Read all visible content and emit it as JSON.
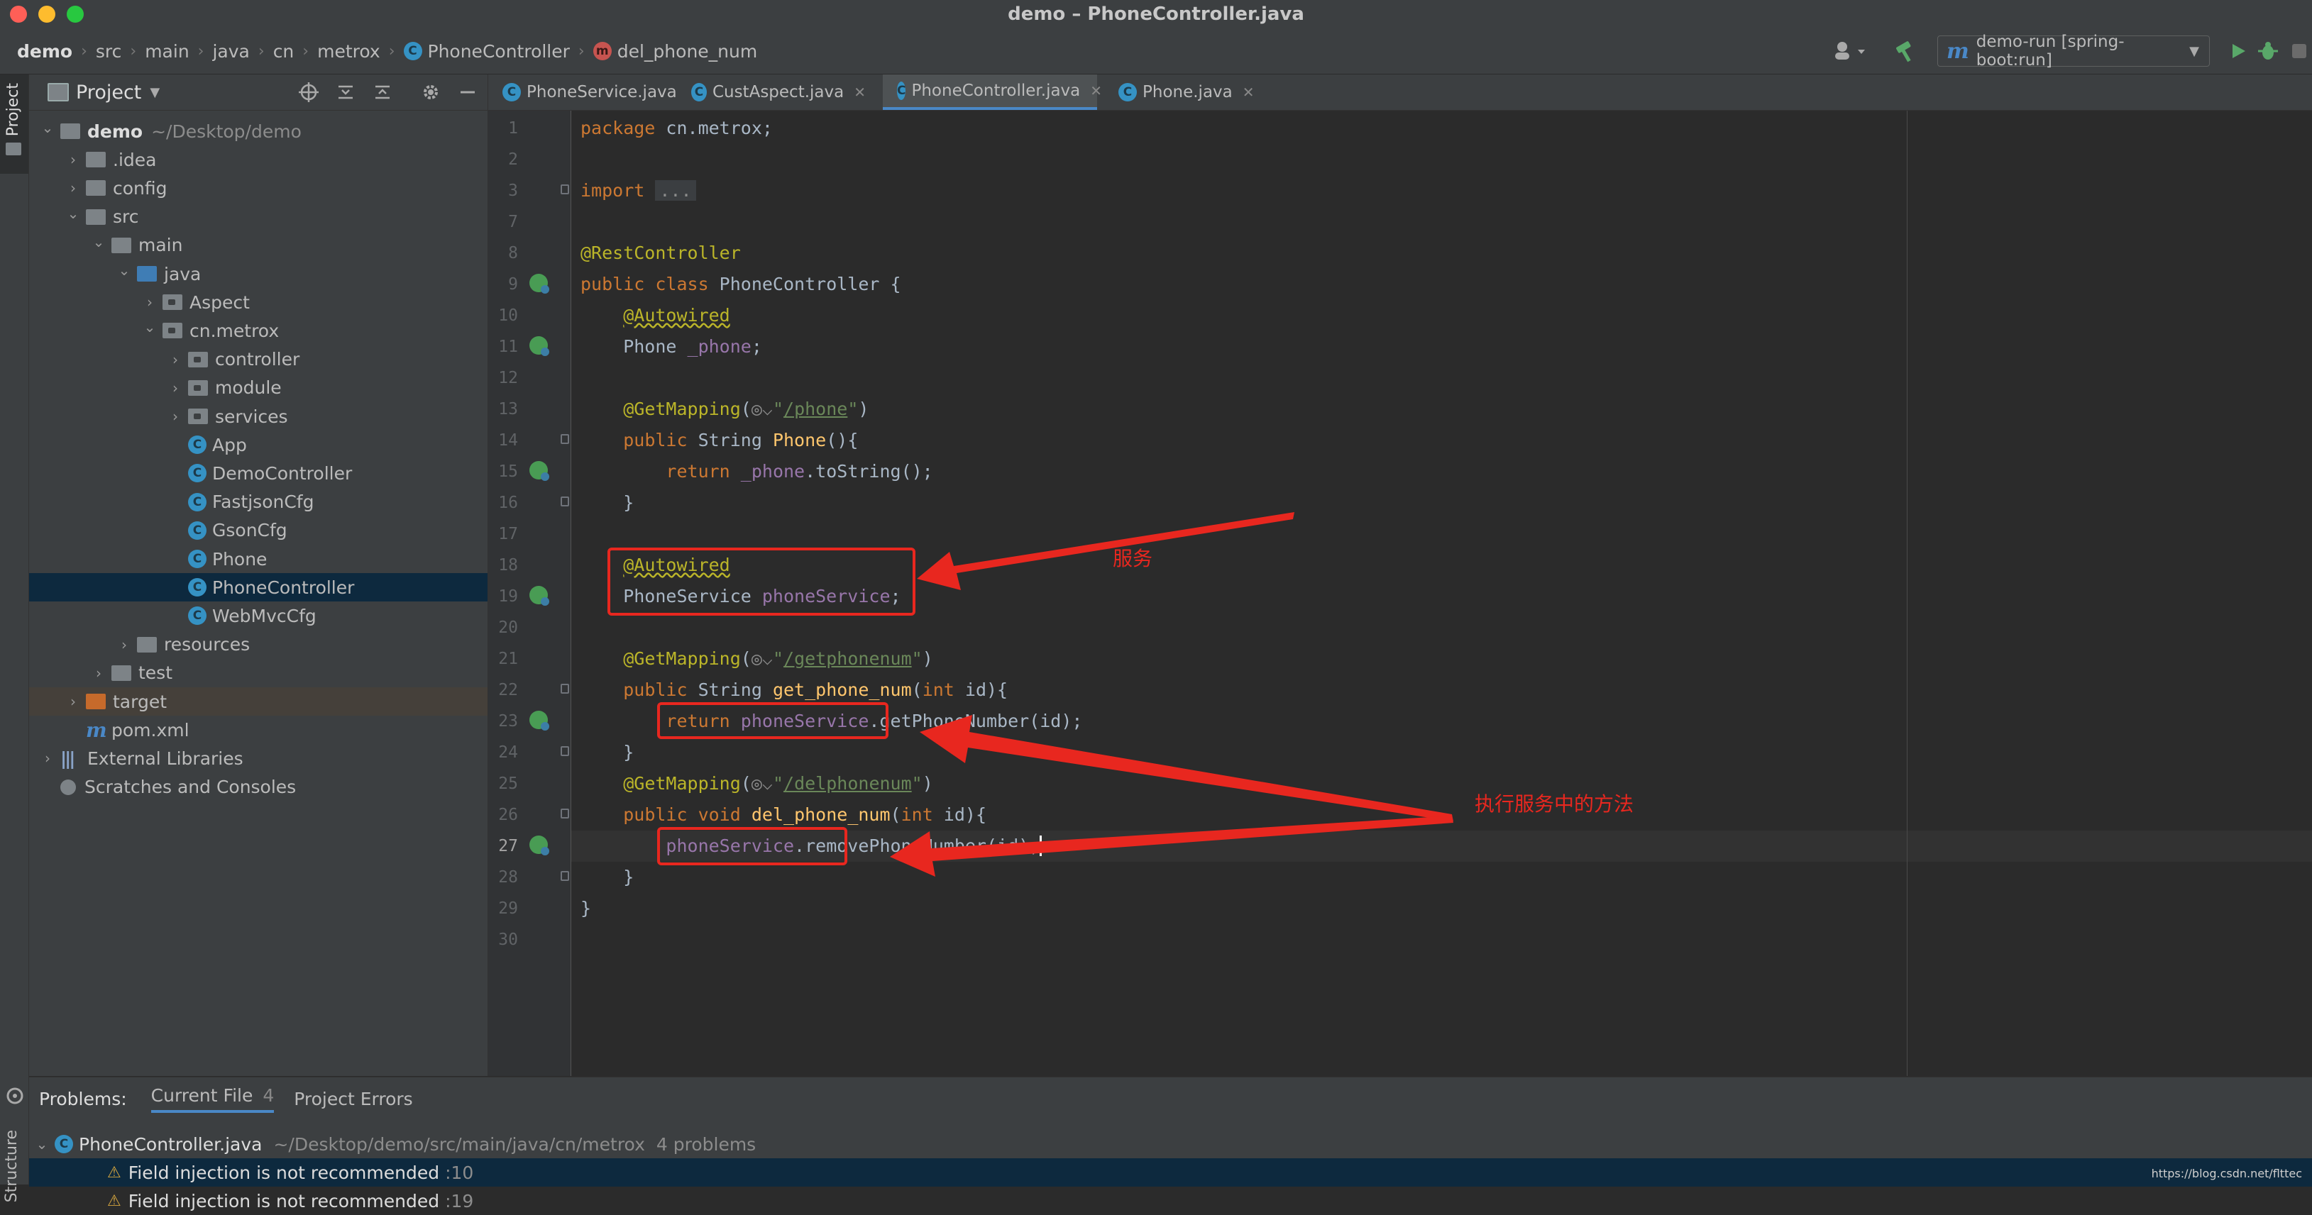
{
  "window": {
    "title": "demo – PhoneController.java"
  },
  "breadcrumb": [
    "demo",
    "src",
    "main",
    "java",
    "cn",
    "metrox",
    "PhoneController",
    "del_phone_num"
  ],
  "toolbar": {
    "run_config": "demo-run [spring-boot:run]",
    "run_config_icon": "m"
  },
  "left_strip": {
    "project_label": "Project",
    "structure_label": "Structure"
  },
  "project": {
    "title": "Project",
    "tree": [
      {
        "label": "demo",
        "suffix": "~/Desktop/demo",
        "level": 0,
        "arrow": "down",
        "icon": "folder"
      },
      {
        "label": ".idea",
        "level": 1,
        "arrow": "right",
        "icon": "folder"
      },
      {
        "label": "config",
        "level": 1,
        "arrow": "right",
        "icon": "folder"
      },
      {
        "label": "src",
        "level": 1,
        "arrow": "down",
        "icon": "folder"
      },
      {
        "label": "main",
        "level": 2,
        "arrow": "down",
        "icon": "folder"
      },
      {
        "label": "java",
        "level": 3,
        "arrow": "down",
        "icon": "folder-blue"
      },
      {
        "label": "Aspect",
        "level": 4,
        "arrow": "right",
        "icon": "package"
      },
      {
        "label": "cn.metrox",
        "level": 4,
        "arrow": "down",
        "icon": "package"
      },
      {
        "label": "controller",
        "level": 5,
        "arrow": "right",
        "icon": "package"
      },
      {
        "label": "module",
        "level": 5,
        "arrow": "right",
        "icon": "package"
      },
      {
        "label": "services",
        "level": 5,
        "arrow": "right",
        "icon": "package"
      },
      {
        "label": "App",
        "level": 5,
        "arrow": "",
        "icon": "class"
      },
      {
        "label": "DemoController",
        "level": 5,
        "arrow": "",
        "icon": "class"
      },
      {
        "label": "FastjsonCfg",
        "level": 5,
        "arrow": "",
        "icon": "class"
      },
      {
        "label": "GsonCfg",
        "level": 5,
        "arrow": "",
        "icon": "class"
      },
      {
        "label": "Phone",
        "level": 5,
        "arrow": "",
        "icon": "class"
      },
      {
        "label": "PhoneController",
        "level": 5,
        "arrow": "",
        "icon": "class",
        "selected": true
      },
      {
        "label": "WebMvcCfg",
        "level": 5,
        "arrow": "",
        "icon": "class"
      },
      {
        "label": "resources",
        "level": 3,
        "arrow": "right",
        "icon": "folder"
      },
      {
        "label": "test",
        "level": 2,
        "arrow": "right",
        "icon": "folder"
      },
      {
        "label": "target",
        "level": 1,
        "arrow": "right",
        "icon": "folder-orange",
        "excluded": true
      },
      {
        "label": "pom.xml",
        "level": 1,
        "arrow": "",
        "icon": "maven"
      },
      {
        "label": "External Libraries",
        "level": 0,
        "arrow": "right",
        "icon": "library"
      },
      {
        "label": "Scratches and Consoles",
        "level": 0,
        "arrow": "",
        "icon": "scratch"
      }
    ]
  },
  "tabs": [
    {
      "label": "PhoneService.java",
      "active": false
    },
    {
      "label": "CustAspect.java",
      "active": false
    },
    {
      "label": "PhoneController.java",
      "active": true
    },
    {
      "label": "Phone.java",
      "active": false
    }
  ],
  "editor": {
    "lines": [
      {
        "n": "1",
        "html": "<span class='kw'>package</span> cn.metrox;"
      },
      {
        "n": "2",
        "html": ""
      },
      {
        "n": "3",
        "html": "<span class='kw'>import</span> <span class='collapsed'>...</span>"
      },
      {
        "n": "7",
        "html": ""
      },
      {
        "n": "8",
        "html": "<span class='ann'>@RestController</span>"
      },
      {
        "n": "9",
        "html": "<span class='kw'>public class</span> PhoneController {"
      },
      {
        "n": "10",
        "html": "    <span class='ann wavy'>@Autowired</span>"
      },
      {
        "n": "11",
        "html": "    Phone <span class='field'>_phone</span>;"
      },
      {
        "n": "12",
        "html": ""
      },
      {
        "n": "13",
        "html": "    <span class='ann'>@GetMapping</span>(<span style='color:#8c8c8c'>◎⌵</span><span class='str'>\"<span class='ul'>/phone</span>\"</span>)"
      },
      {
        "n": "14",
        "html": "    <span class='kw'>public</span> String <span class='fn'>Phone</span>(){"
      },
      {
        "n": "15",
        "html": "        <span class='kw'>return</span> <span class='field'>_phone</span>.toString();"
      },
      {
        "n": "16",
        "html": "    }"
      },
      {
        "n": "17",
        "html": ""
      },
      {
        "n": "18",
        "html": "    <span class='ann wavy'>@Autowired</span>"
      },
      {
        "n": "19",
        "html": "    PhoneService <span class='field'>phoneService</span>;"
      },
      {
        "n": "20",
        "html": ""
      },
      {
        "n": "21",
        "html": "    <span class='ann'>@GetMapping</span>(<span style='color:#8c8c8c'>◎⌵</span><span class='str'>\"<span class='ul'>/getphonenum</span>\"</span>)"
      },
      {
        "n": "22",
        "html": "    <span class='kw'>public</span> String <span class='fn'>get_phone_num</span>(<span class='kw'>int</span> id){"
      },
      {
        "n": "23",
        "html": "        <span class='kw'>return</span> <span class='field'>phoneService</span>.getPhoneNumber(id);"
      },
      {
        "n": "24",
        "html": "    }"
      },
      {
        "n": "25",
        "html": "    <span class='ann'>@GetMapping</span>(<span style='color:#8c8c8c'>◎⌵</span><span class='str'>\"<span class='ul'>/delphonenum</span>\"</span>)"
      },
      {
        "n": "26",
        "html": "    <span class='kw'>public void</span> <span class='fn'>del_phone_num</span>(<span class='kw'>int</span> id){"
      },
      {
        "n": "27",
        "html": "        <span class='field'>phoneService</span>.removePhoneNumber(id);<span style='border-left:3px solid #ffffff'></span>"
      },
      {
        "n": "28",
        "html": "    }"
      },
      {
        "n": "29",
        "html": "}"
      },
      {
        "n": "30",
        "html": ""
      }
    ],
    "annotations": {
      "service_label": "服务",
      "call_label": "执行服务中的方法"
    }
  },
  "problems": {
    "title": "Problems:",
    "tabs": [
      {
        "label": "Current File",
        "count": "4",
        "active": true
      },
      {
        "label": "Project Errors",
        "count": "",
        "active": false
      }
    ],
    "file": {
      "name": "PhoneController.java",
      "path": "~/Desktop/demo/src/main/java/cn/metrox",
      "count": "4 problems"
    },
    "items": [
      {
        "text": "Field injection is not recommended",
        "location": ":10"
      },
      {
        "text": "Field injection is not recommended",
        "location": ":19"
      }
    ]
  },
  "watermark": "https://blog.csdn.net/flttec",
  "colors": {
    "accent": "#4a88c7",
    "annotation_red": "#e8271f",
    "selection": "#0d293e"
  }
}
